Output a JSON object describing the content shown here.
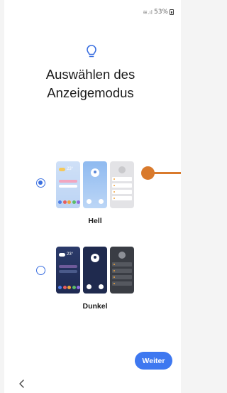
{
  "status_bar": {
    "battery": "53%"
  },
  "title_line1": "Auswählen des",
  "title_line2": "Anzeigemodus",
  "options": [
    {
      "label": "Hell",
      "selected": true,
      "preview_weather": "23°"
    },
    {
      "label": "Dunkel",
      "selected": false,
      "preview_weather": "23°"
    }
  ],
  "next_button": "Weiter",
  "colors": {
    "accent": "#3e78f0",
    "radio": "#3a6fe0",
    "touch_indicator": "#d97a2c"
  },
  "icons": {
    "header": "lightbulb-icon",
    "back": "chevron-left-icon"
  }
}
